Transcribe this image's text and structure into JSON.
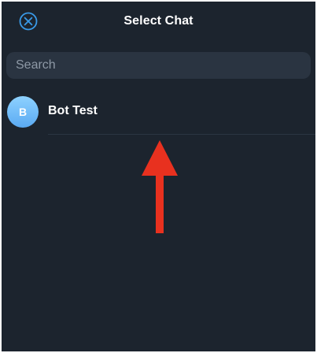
{
  "header": {
    "title": "Select Chat",
    "close_icon": "close-icon"
  },
  "search": {
    "placeholder": "Search",
    "value": ""
  },
  "chats": [
    {
      "avatar_letter": "B",
      "name": "Bot Test"
    }
  ],
  "annotation": {
    "icon": "arrow-up-icon",
    "color": "#e8311f"
  },
  "colors": {
    "background": "#1c242e",
    "accent": "#3a9ae8",
    "search_bg": "#2a3441"
  }
}
